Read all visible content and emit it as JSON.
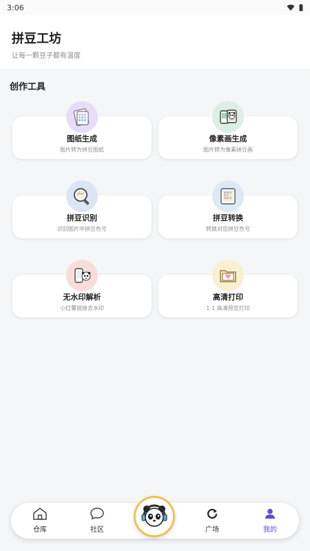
{
  "status_bar": {
    "time": "3:06"
  },
  "header": {
    "title": "拼豆工坊",
    "subtitle": "让每一颗豆子都有温度"
  },
  "section": {
    "title": "创作工具"
  },
  "tools": [
    {
      "title": "图纸生成",
      "desc": "图片转为拼豆图纸",
      "icon": "pattern-sheet-icon",
      "color": "#e7ddf6"
    },
    {
      "title": "像素画生成",
      "desc": "图片转为像素拼豆画",
      "icon": "pixel-panda-icon",
      "color": "#dcefe4"
    },
    {
      "title": "拼豆识别",
      "desc": "识别图片中拼豆色号",
      "icon": "magnifier-icon",
      "color": "#dde5f3"
    },
    {
      "title": "拼豆转换",
      "desc": "转换对应拼豆色号",
      "icon": "convert-board-icon",
      "color": "#dde9f5"
    },
    {
      "title": "无水印解析",
      "desc": "小红薯链接去水印",
      "icon": "phone-panda-icon",
      "color": "#f7dedd"
    },
    {
      "title": "高清打印",
      "desc": "1:1 高清预览打印",
      "icon": "print-folder-icon",
      "color": "#f8f0cf"
    }
  ],
  "tabbar": {
    "tabs": [
      {
        "label": "仓库",
        "icon": "home-icon"
      },
      {
        "label": "社区",
        "icon": "chat-bubble-icon"
      },
      {
        "label": "广场",
        "icon": "refresh-icon"
      },
      {
        "label": "我的",
        "icon": "person-icon"
      }
    ],
    "center_icon": "panda-headphones-icon",
    "active_tab": "我的",
    "active_color": "#5b4fd9"
  }
}
